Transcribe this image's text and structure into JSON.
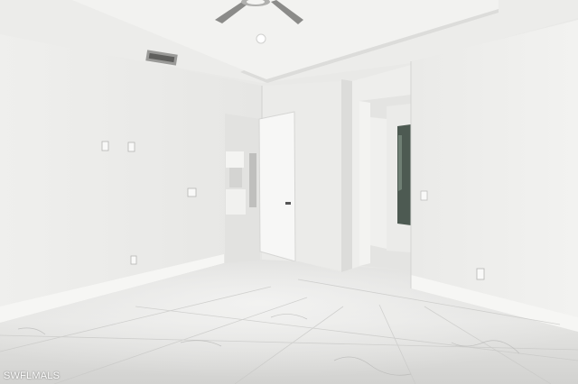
{
  "watermark": {
    "text": "SWFLMALS"
  }
}
